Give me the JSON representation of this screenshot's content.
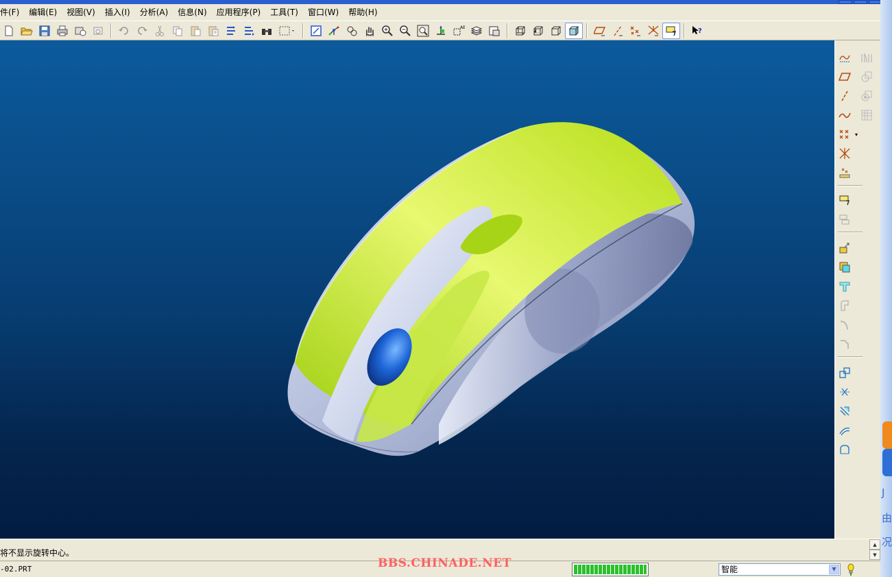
{
  "menubar": {
    "items": [
      "件(F)",
      "编辑(E)",
      "视图(V)",
      "插入(I)",
      "分析(A)",
      "信息(N)",
      "应用程序(P)",
      "工具(T)",
      "窗口(W)",
      "帮助(H)"
    ]
  },
  "toolbar": {
    "icons": [
      "new-file-icon",
      "open-folder-icon",
      "save-icon",
      "print-icon",
      "send-mail-icon",
      "close-window-icon",
      "undo-icon",
      "redo-icon",
      "cut-icon",
      "copy-icon",
      "paste-icon",
      "paste-special-icon",
      "regenerate-icon",
      "regen-manager-icon",
      "find-binoculars-icon",
      "selection-box-icon",
      "repaint-icon",
      "spin-center-icon",
      "orient-mode-icon",
      "pan-hand-icon",
      "zoom-in-icon",
      "zoom-out-icon",
      "refit-icon",
      "reorient-icon",
      "saved-views-icon",
      "layers-icon",
      "view-manager-icon",
      "wireframe-icon",
      "hidden-line-icon",
      "no-hidden-icon",
      "shading-icon",
      "datum-planes-icon",
      "datum-axes-icon",
      "datum-points-icon",
      "coord-systems-icon",
      "annotation-icon",
      "whats-this-help-icon"
    ]
  },
  "right_toolbar": {
    "icons": [
      "sketch-icon",
      "datum-plane-icon",
      "datum-axis-icon",
      "datum-curve-icon",
      "datum-point-icon",
      "datum-point-sketch-icon",
      "datum-point-offset-icon",
      "coordinate-system-icon",
      "analysis-feature-icon",
      "insert-extrude-icon",
      "insert-revolve-icon",
      "variable-section-sweep-icon",
      "boundary-blend-icon",
      "round-icon",
      "chamfer-icon",
      "draft-icon",
      "shell-icon",
      "rib-icon",
      "hole-icon",
      "mirror-icon",
      "merge-icon",
      "trim-icon",
      "extend-icon",
      "offset-icon",
      "thicken-icon",
      "solidify-icon",
      "pattern-icon",
      "copy-geometry-icon"
    ]
  },
  "message_area": {
    "message": "将不显示旋转中心。"
  },
  "status_bar": {
    "filename": "-02.PRT",
    "watermark": "BBS.CHINADE.NET",
    "progress_fraction": 1.0,
    "filter_value": "智能"
  },
  "colors": {
    "viewport_top": "#0c5a9c",
    "viewport_bottom": "#031c40",
    "mouse_top_shell": "#b8e020",
    "mouse_body": "#c8d0e8",
    "scroll_wheel": "#1e66d8",
    "watermark": "#ff6060"
  },
  "desktop_edge": {
    "glyphs": [
      "J",
      "由",
      "况"
    ]
  }
}
